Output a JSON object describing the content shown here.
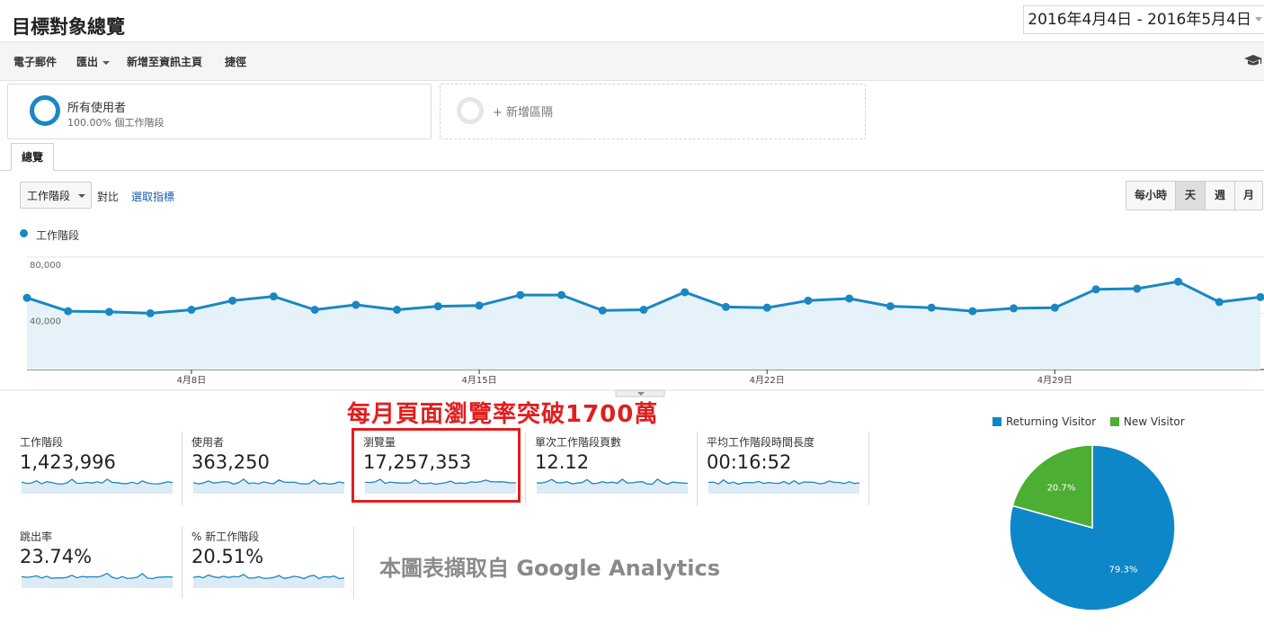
{
  "header": {
    "title": "目標對象總覽",
    "date_range": "2016年4月4日 - 2016年5月4日"
  },
  "toolbar": {
    "email": "電子郵件",
    "export": "匯出",
    "add_to_dashboard": "新增至資訊主頁",
    "shortcut": "捷徑"
  },
  "segments": {
    "all_users": {
      "name": "所有使用者",
      "detail": "100.00% 個工作階段"
    },
    "add_segment": "+ 新增區隔"
  },
  "tabs": {
    "overview": "總覽"
  },
  "controls": {
    "metric": "工作階段",
    "vs": "對比",
    "select_metric": "選取指標",
    "granularity": [
      "每小時",
      "天",
      "週",
      "月"
    ],
    "selected_granularity": "天"
  },
  "colors": {
    "accent": "#1a87c2",
    "new_visitor": "#4cae32",
    "annotation": "#e01e1e"
  },
  "chart_data": [
    {
      "type": "line",
      "series": [
        {
          "name": "工作階段",
          "values": [
            51000,
            41500,
            41000,
            40000,
            42500,
            49000,
            52000,
            42500,
            46000,
            42500,
            45000,
            45500,
            53000,
            53000,
            42000,
            42500,
            55000,
            44500,
            44000,
            49000,
            50500,
            45000,
            44000,
            41500,
            43500,
            44000,
            57000,
            57500,
            62500,
            48000,
            51500
          ]
        }
      ],
      "x": [
        "4/4",
        "4/5",
        "4/6",
        "4/7",
        "4/8",
        "4/9",
        "4/10",
        "4/11",
        "4/12",
        "4/13",
        "4/14",
        "4/15",
        "4/16",
        "4/17",
        "4/18",
        "4/19",
        "4/20",
        "4/21",
        "4/22",
        "4/23",
        "4/24",
        "4/25",
        "4/26",
        "4/27",
        "4/28",
        "4/29",
        "4/30",
        "5/1",
        "5/2",
        "5/3",
        "5/4"
      ],
      "x_tick_labels": [
        "4月8日",
        "4月15日",
        "4月22日",
        "4月29日"
      ],
      "y_tick_labels": [
        "80,000",
        "40,000"
      ],
      "ylim": [
        0,
        90000
      ]
    },
    {
      "type": "pie",
      "categories": [
        "Returning Visitor",
        "New Visitor"
      ],
      "values": [
        79.3,
        20.7
      ],
      "labels": [
        "79.3%",
        "20.7%"
      ],
      "colors": [
        "#0e87c8",
        "#4cae32"
      ],
      "legend": "top"
    }
  ],
  "scorecards": [
    {
      "label": "工作階段",
      "value": "1,423,996"
    },
    {
      "label": "使用者",
      "value": "363,250"
    },
    {
      "label": "瀏覽量",
      "value": "17,257,353"
    },
    {
      "label": "單次工作階段頁數",
      "value": "12.12"
    },
    {
      "label": "平均工作階段時間長度",
      "value": "00:16:52"
    },
    {
      "label": "跳出率",
      "value": "23.74%"
    },
    {
      "label": "% 新工作階段",
      "value": "20.51%"
    }
  ],
  "annotation": "每月頁面瀏覽率突破1700萬",
  "source_note": "本圖表擷取自 Google Analytics"
}
